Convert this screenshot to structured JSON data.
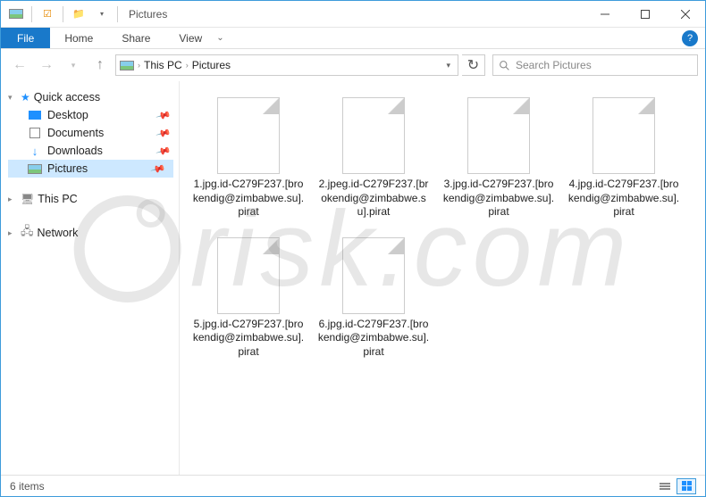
{
  "title": "Pictures",
  "ribbon": {
    "file": "File",
    "tabs": [
      "Home",
      "Share",
      "View"
    ]
  },
  "breadcrumbs": [
    "This PC",
    "Pictures"
  ],
  "search_placeholder": "Search Pictures",
  "sidebar": {
    "quick_access": "Quick access",
    "items": [
      {
        "label": "Desktop",
        "icon": "desk",
        "pinned": true
      },
      {
        "label": "Documents",
        "icon": "doc",
        "pinned": true
      },
      {
        "label": "Downloads",
        "icon": "dl",
        "pinned": true
      },
      {
        "label": "Pictures",
        "icon": "pic",
        "pinned": true,
        "selected": true
      }
    ],
    "this_pc": "This PC",
    "network": "Network"
  },
  "files": [
    {
      "name": "1.jpg.id-C279F237.[brokendig@zimbabwe.su].pirat"
    },
    {
      "name": "2.jpeg.id-C279F237.[brokendig@zimbabwe.su].pirat"
    },
    {
      "name": "3.jpg.id-C279F237.[brokendig@zimbabwe.su].pirat"
    },
    {
      "name": "4.jpg.id-C279F237.[brokendig@zimbabwe.su].pirat"
    },
    {
      "name": "5.jpg.id-C279F237.[brokendig@zimbabwe.su].pirat"
    },
    {
      "name": "6.jpg.id-C279F237.[brokendig@zimbabwe.su].pirat"
    }
  ],
  "status": "6 items",
  "watermark": "risk.com"
}
